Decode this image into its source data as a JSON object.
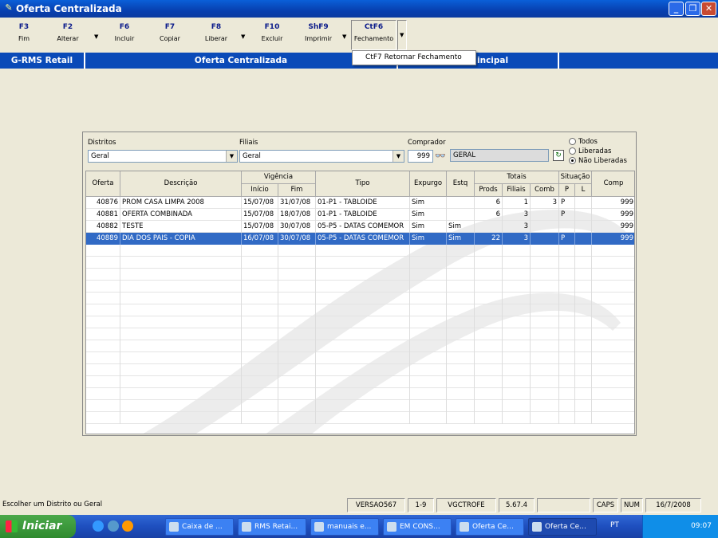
{
  "window": {
    "title": "Oferta Centralizada"
  },
  "toolbar": [
    {
      "key": "F3",
      "label": "Fim"
    },
    {
      "key": "F2",
      "label": "Alterar"
    },
    {
      "key": "F6",
      "label": "Incluir"
    },
    {
      "key": "F7",
      "label": "Copiar"
    },
    {
      "key": "F8",
      "label": "Liberar"
    },
    {
      "key": "F10",
      "label": "Excluir"
    },
    {
      "key": "ShF9",
      "label": "Imprimir"
    },
    {
      "key": "CtF6",
      "label": "Fechamento"
    }
  ],
  "dropdown_menu": {
    "item": "CtF7  Retornar Fechamento"
  },
  "header_bar": {
    "app": "G-RMS Retail",
    "module": "Oferta Centralizada",
    "partial": "incipal"
  },
  "filters": {
    "distritos_label": "Distritos",
    "distritos_value": "Geral",
    "filiais_label": "Filiais",
    "filiais_value": "Geral",
    "comprador_label": "Comprador",
    "comprador_code": "999",
    "comprador_name": "GERAL",
    "radio_options": [
      "Todos",
      "Liberadas",
      "Não Liberadas"
    ],
    "radio_selected": "Não Liberadas"
  },
  "grid": {
    "headers": {
      "oferta": "Oferta",
      "descricao": "Descrição",
      "vigencia": "Vigência",
      "inicio": "Início",
      "fim": "Fim",
      "tipo": "Tipo",
      "expurgo": "Expurgo",
      "estq": "Estq",
      "totais": "Totais",
      "prods": "Prods",
      "filiais": "Filiais",
      "comb": "Comb",
      "situacao": "Situação",
      "p": "P",
      "l": "L",
      "comp": "Comp"
    },
    "rows": [
      {
        "oferta": "40876",
        "descricao": "PROM CASA LIMPA 2008",
        "inicio": "15/07/08",
        "fim": "31/07/08",
        "tipo": "01-P1 - TABLOIDE",
        "expurgo": "Sim",
        "estq": "",
        "prods": "6",
        "filiais": "1",
        "comb": "3",
        "p": "P",
        "l": "",
        "comp": "999"
      },
      {
        "oferta": "40881",
        "descricao": "OFERTA COMBINADA",
        "inicio": "15/07/08",
        "fim": "18/07/08",
        "tipo": "01-P1 - TABLOIDE",
        "expurgo": "Sim",
        "estq": "",
        "prods": "6",
        "filiais": "3",
        "comb": "",
        "p": "P",
        "l": "",
        "comp": "999"
      },
      {
        "oferta": "40882",
        "descricao": "TESTE",
        "inicio": "15/07/08",
        "fim": "30/07/08",
        "tipo": "05-P5 - DATAS COMEMOR",
        "expurgo": "Sim",
        "estq": "Sim",
        "prods": "",
        "filiais": "3",
        "comb": "",
        "p": "",
        "l": "",
        "comp": "999"
      },
      {
        "oferta": "40889",
        "descricao": "DIA DOS PAIS - COPIA",
        "inicio": "16/07/08",
        "fim": "30/07/08",
        "tipo": "05-P5 - DATAS COMEMOR",
        "expurgo": "Sim",
        "estq": "Sim",
        "prods": "22",
        "filiais": "3",
        "comb": "",
        "p": "P",
        "l": "",
        "comp": "999"
      }
    ],
    "selected_row": 3
  },
  "statusbar": {
    "message": "Escolher um Distrito ou Geral",
    "version": "VERSAO567",
    "pages": "1-9",
    "program": "VGCTROFE",
    "build": "5.67.4",
    "caps": "CAPS",
    "num": "NUM",
    "date": "16/7/2008"
  },
  "taskbar": {
    "start": "Iniciar",
    "tasks": [
      "Caixa de ...",
      "RMS Retai...",
      "manuais e...",
      "EM CONS...",
      "Oferta Ce...",
      "Oferta Ce..."
    ],
    "lang": "PT",
    "clock": "09:07"
  }
}
